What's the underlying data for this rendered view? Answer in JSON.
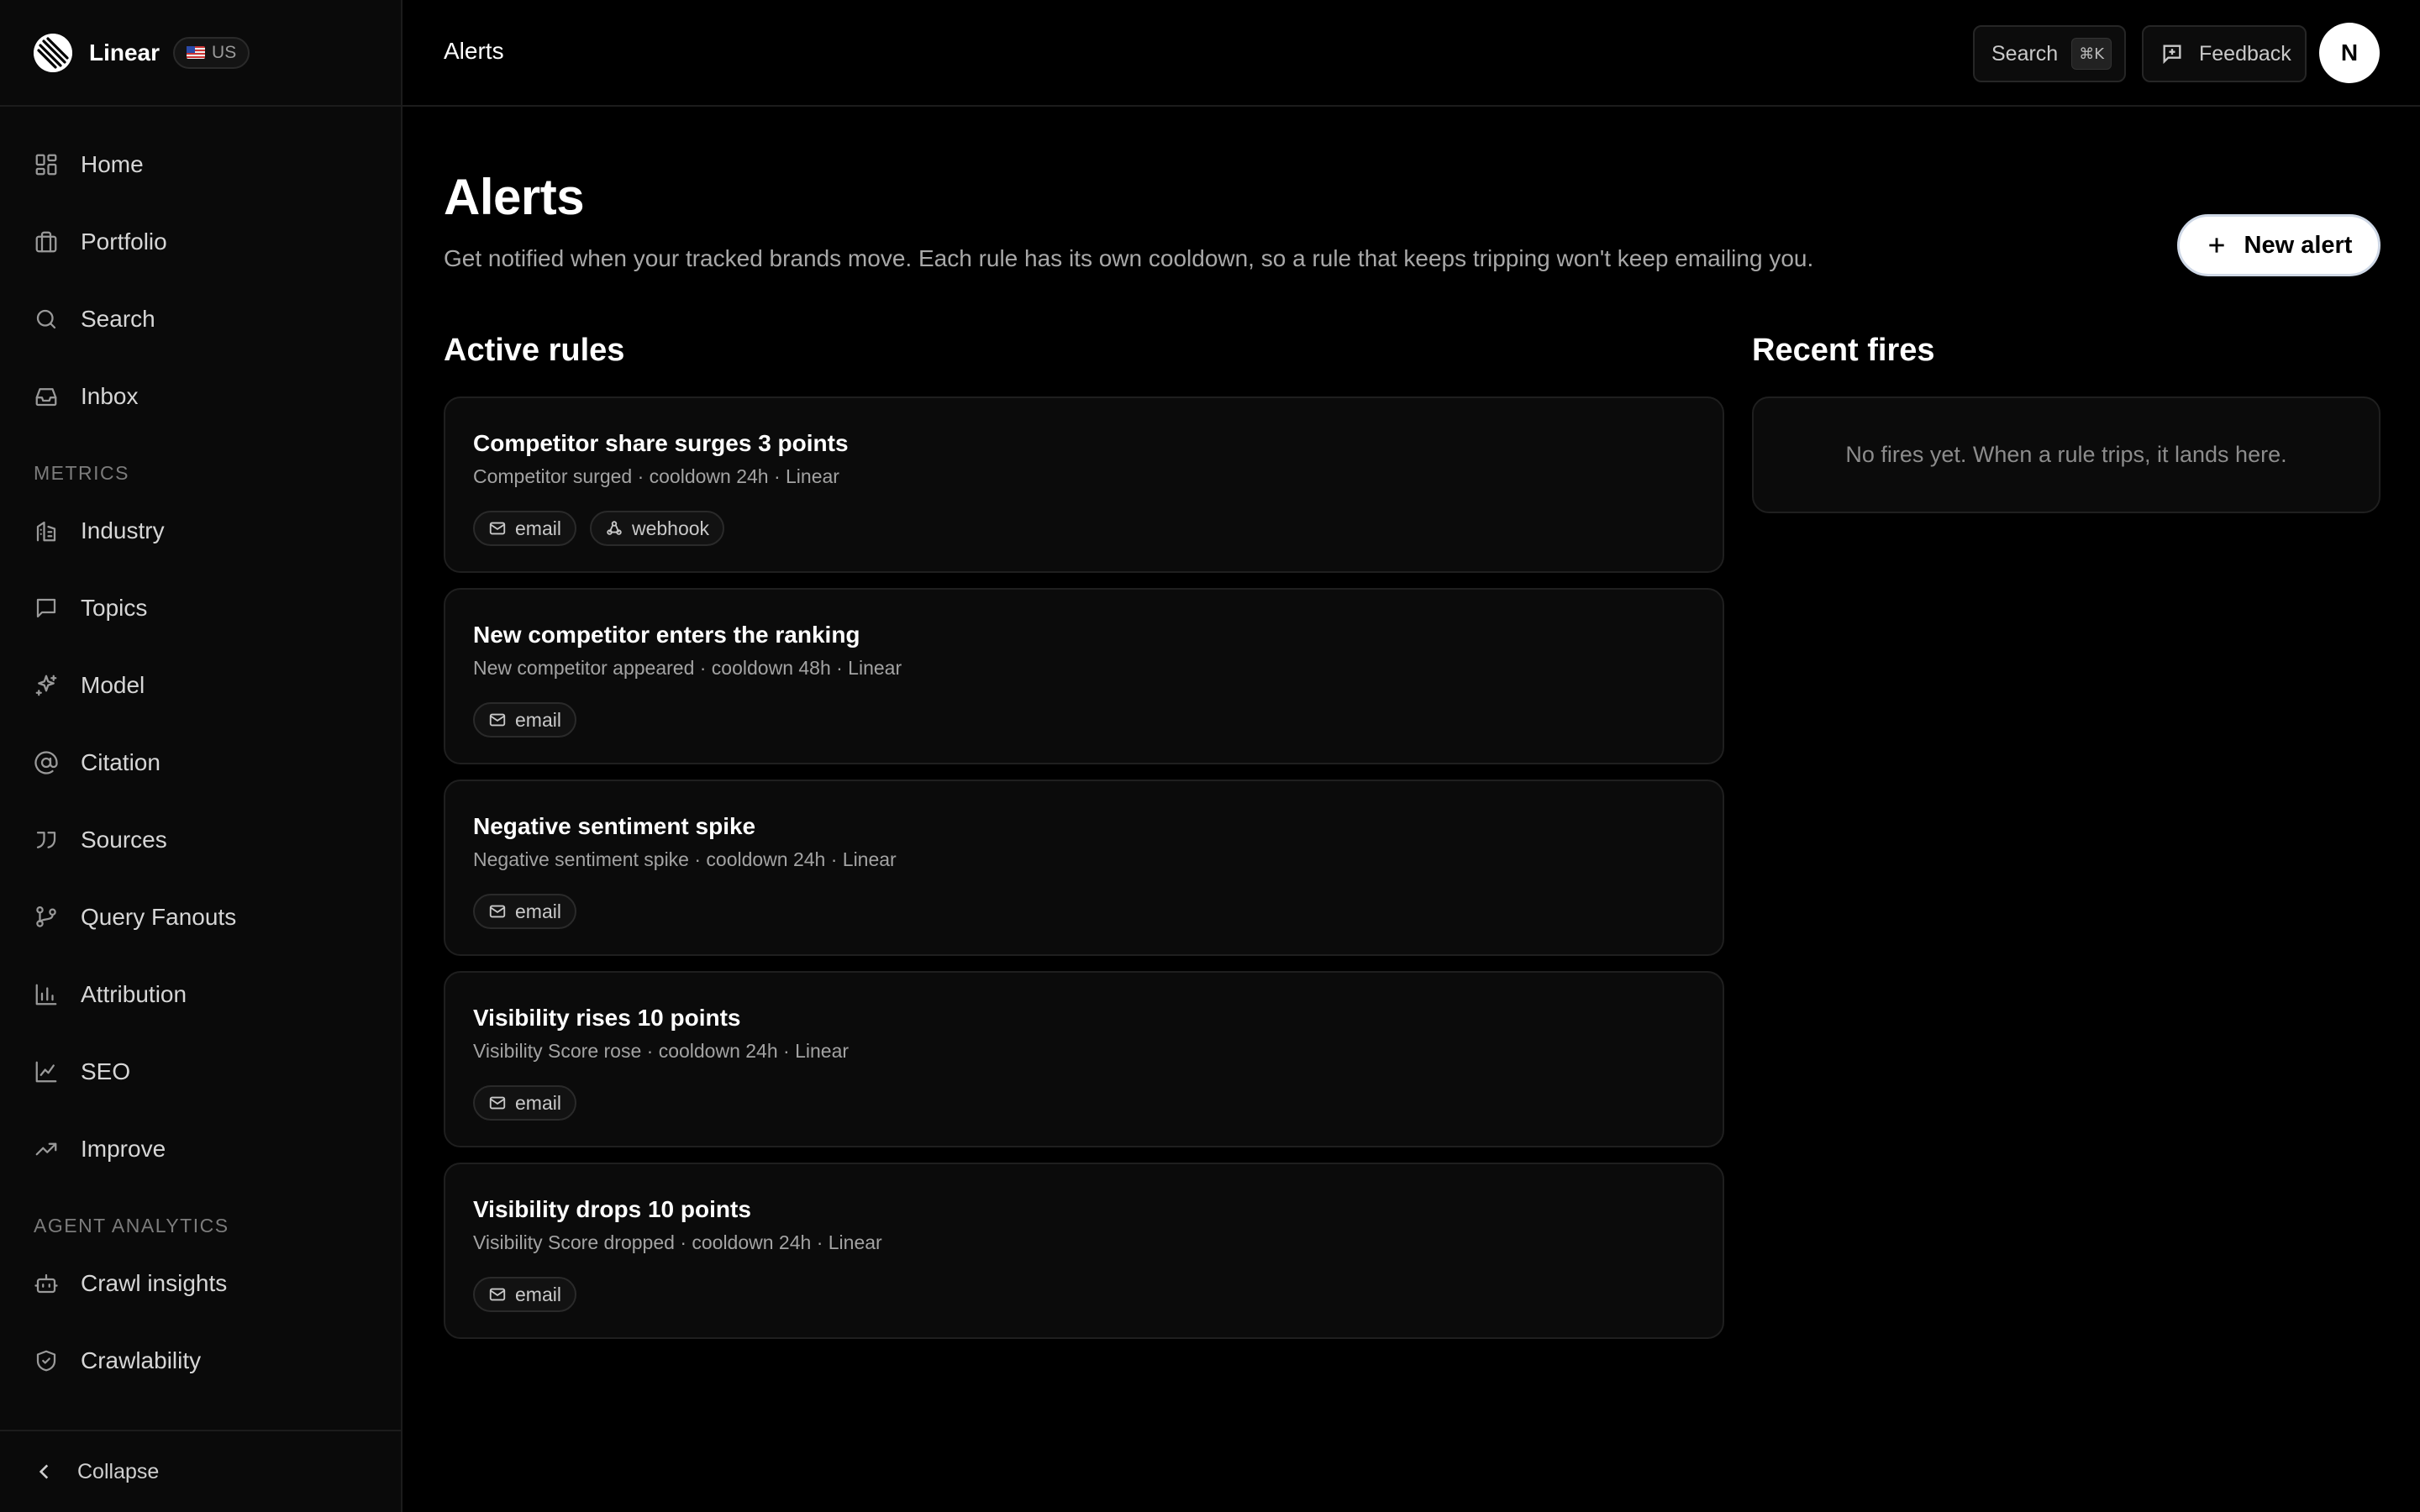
{
  "brand": {
    "name": "Linear",
    "region": "US"
  },
  "sidebar": {
    "main_items": [
      {
        "label": "Home",
        "icon": "dashboard-icon"
      },
      {
        "label": "Portfolio",
        "icon": "briefcase-icon"
      },
      {
        "label": "Search",
        "icon": "search-icon"
      },
      {
        "label": "Inbox",
        "icon": "inbox-icon"
      }
    ],
    "metrics_label": "METRICS",
    "metrics_items": [
      {
        "label": "Industry",
        "icon": "building-icon"
      },
      {
        "label": "Topics",
        "icon": "message-square-icon"
      },
      {
        "label": "Model",
        "icon": "sparkles-icon"
      },
      {
        "label": "Citation",
        "icon": "at-sign-icon"
      },
      {
        "label": "Sources",
        "icon": "quote-icon"
      },
      {
        "label": "Query Fanouts",
        "icon": "git-branch-icon"
      },
      {
        "label": "Attribution",
        "icon": "bar-chart-icon"
      },
      {
        "label": "SEO",
        "icon": "line-chart-icon"
      },
      {
        "label": "Improve",
        "icon": "trending-up-icon"
      }
    ],
    "agent_label": "AGENT ANALYTICS",
    "agent_items": [
      {
        "label": "Crawl insights",
        "icon": "bot-icon"
      },
      {
        "label": "Crawlability",
        "icon": "shield-check-icon"
      }
    ],
    "collapse_label": "Collapse"
  },
  "topbar": {
    "title": "Alerts",
    "search_label": "Search",
    "search_shortcut": "⌘K",
    "feedback_label": "Feedback",
    "avatar_initial": "N"
  },
  "main": {
    "title": "Alerts",
    "description": "Get notified when your tracked brands move. Each rule has its own cooldown, so a rule that keeps tripping won't keep emailing you.",
    "new_alert_label": "New alert",
    "active_rules_title": "Active rules",
    "recent_fires_title": "Recent fires",
    "recent_fires_empty": "No fires yet. When a rule trips, it lands here.",
    "rules": [
      {
        "name": "Competitor share surges 3 points",
        "meta": "Competitor surged · cooldown 24h · Linear",
        "channels": [
          "email",
          "webhook"
        ]
      },
      {
        "name": "New competitor enters the ranking",
        "meta": "New competitor appeared · cooldown 48h · Linear",
        "channels": [
          "email"
        ]
      },
      {
        "name": "Negative sentiment spike",
        "meta": "Negative sentiment spike · cooldown 24h · Linear",
        "channels": [
          "email"
        ]
      },
      {
        "name": "Visibility rises 10 points",
        "meta": "Visibility Score rose · cooldown 24h · Linear",
        "channels": [
          "email"
        ]
      },
      {
        "name": "Visibility drops 10 points",
        "meta": "Visibility Score dropped · cooldown 24h · Linear",
        "channels": [
          "email"
        ]
      }
    ]
  }
}
